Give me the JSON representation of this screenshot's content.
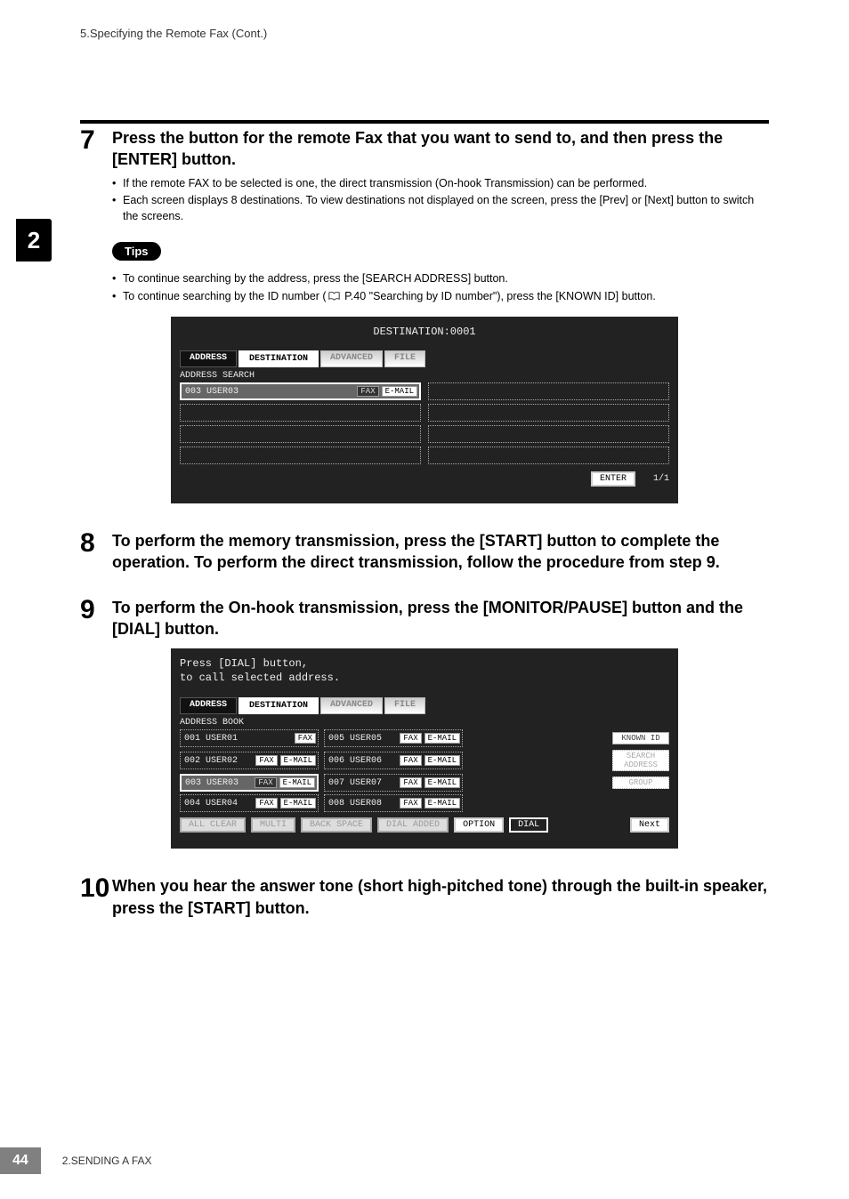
{
  "header": {
    "section_title": "5.Specifying the Remote Fax (Cont.)"
  },
  "side_tab": {
    "label": "2"
  },
  "step7": {
    "num": "7",
    "title": "Press the button for the remote Fax that you want to send to, and then press the [ENTER] button.",
    "bullets": [
      "If the remote FAX to be selected is one, the direct transmission (On-hook Transmission) can be performed.",
      "Each screen displays 8 destinations. To view destinations not displayed on the screen, press the [Prev] or [Next] button to switch the screens."
    ]
  },
  "tips": {
    "label": "Tips",
    "bullets_a": "To continue searching by the address, press the [SEARCH ADDRESS] button.",
    "bullets_b_pre": "To continue searching by the ID number (",
    "bullets_b_post": " P.40 \"Searching by ID number\"), press the [KNOWN ID] button."
  },
  "screen1": {
    "top": "DESTINATION:0001",
    "tabs": {
      "address": "ADDRESS",
      "destination": "DESTINATION",
      "advanced": "ADVANCED",
      "file": "FILE"
    },
    "sub": "ADDRESS SEARCH",
    "entry_id": "003",
    "entry_name": "USER03",
    "chip_fax": "FAX",
    "chip_email": "E-MAIL",
    "enter": "ENTER",
    "page": "1/1"
  },
  "step8": {
    "num": "8",
    "title": "To perform the memory transmission, press the [START] button to complete the operation. To perform the direct transmission, follow the procedure from step 9."
  },
  "step9": {
    "num": "9",
    "title": "To perform the On-hook transmission, press the [MONITOR/PAUSE] button and the [DIAL] button."
  },
  "screen2": {
    "line1": "Press [DIAL] button,",
    "line2": "to call selected address.",
    "tabs": {
      "address": "ADDRESS",
      "destination": "DESTINATION",
      "advanced": "ADVANCED",
      "file": "FILE"
    },
    "sub": "ADDRESS BOOK",
    "rows": [
      {
        "id": "001",
        "name": "USER01",
        "fax": "FAX",
        "email": ""
      },
      {
        "id": "002",
        "name": "USER02",
        "fax": "FAX",
        "email": "E-MAIL"
      },
      {
        "id": "003",
        "name": "USER03",
        "fax": "FAX",
        "email": "E-MAIL",
        "selected": true
      },
      {
        "id": "004",
        "name": "USER04",
        "fax": "FAX",
        "email": "E-MAIL"
      },
      {
        "id": "005",
        "name": "USER05",
        "fax": "FAX",
        "email": "E-MAIL"
      },
      {
        "id": "006",
        "name": "USER06",
        "fax": "FAX",
        "email": "E-MAIL"
      },
      {
        "id": "007",
        "name": "USER07",
        "fax": "FAX",
        "email": "E-MAIL"
      },
      {
        "id": "008",
        "name": "USER08",
        "fax": "FAX",
        "email": "E-MAIL"
      }
    ],
    "right": {
      "known": "KNOWN ID",
      "search": "SEARCH ADDRESS",
      "group": "GROUP"
    },
    "bottom": {
      "allclear": "ALL CLEAR",
      "multi": "MULTI",
      "backspace": "BACK SPACE",
      "dialadded": "DIAL ADDED",
      "option": "OPTION",
      "dial": "DIAL",
      "next": "Next"
    }
  },
  "step10": {
    "num": "10",
    "title": "When you hear the answer tone (short high-pitched tone) through the built-in speaker, press the [START] button."
  },
  "footer": {
    "page": "44",
    "text": "2.SENDING A FAX"
  }
}
